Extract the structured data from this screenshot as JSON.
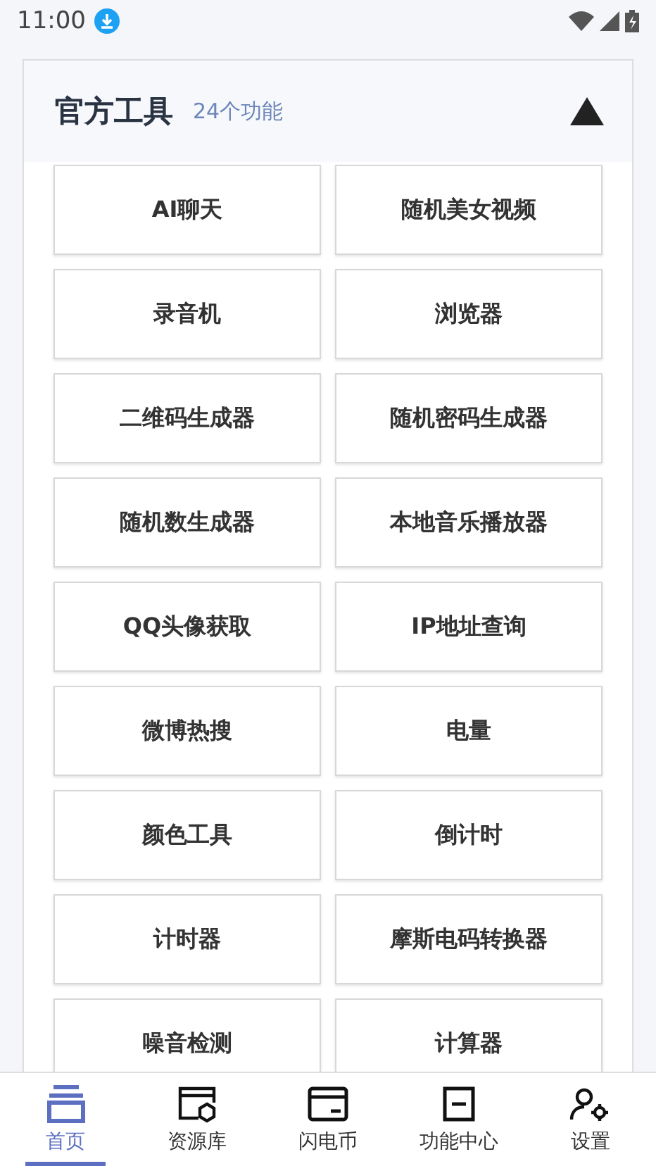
{
  "status_bar": {
    "time": "11:00"
  },
  "section": {
    "title": "官方工具",
    "count": "24个功能",
    "expanded": true,
    "tools": [
      "AI聊天",
      "随机美女视频",
      "录音机",
      "浏览器",
      "二维码生成器",
      "随机密码生成器",
      "随机数生成器",
      "本地音乐播放器",
      "QQ头像获取",
      "IP地址查询",
      "微博热搜",
      "电量",
      "颜色工具",
      "倒计时",
      "计时器",
      "摩斯电码转换器",
      "噪音检测",
      "计算器"
    ]
  },
  "bottom_nav": [
    {
      "label": "首页",
      "kind": "home",
      "selected": true
    },
    {
      "label": "资源库",
      "kind": "library",
      "selected": false
    },
    {
      "label": "闪电币",
      "kind": "wallet",
      "selected": false
    },
    {
      "label": "功能中心",
      "kind": "scan",
      "selected": false
    },
    {
      "label": "设置",
      "kind": "settings",
      "selected": false
    }
  ]
}
